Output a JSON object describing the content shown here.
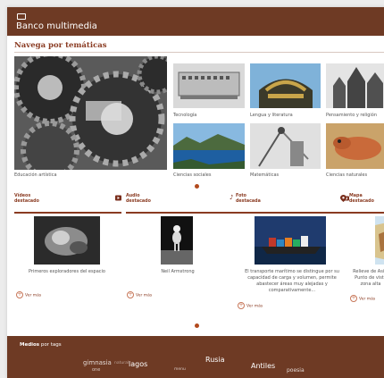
{
  "header": {
    "title": "Banco multimedia",
    "icon": "monitor-icon"
  },
  "themes": {
    "title": "Navega por temáticas",
    "items": [
      {
        "label": "Educación artística"
      },
      {
        "label": "Tecnología"
      },
      {
        "label": "Lengua y literatura"
      },
      {
        "label": "Pensamiento y religión"
      },
      {
        "label": "Ciencias sociales"
      },
      {
        "label": "Matemáticas"
      },
      {
        "label": "Ciencias naturales"
      }
    ]
  },
  "media": [
    {
      "label": "Vídeos destacado",
      "line1": "Vídeos",
      "line2": "destacado",
      "icon": "play-icon",
      "caption": "Primeros exploradores del espacio",
      "more": "Ver más"
    },
    {
      "label": "Audio destacado",
      "line1": "Audio",
      "line2": "destacado",
      "icon": "music-note-icon",
      "caption": "Neil Armstrong",
      "more": "Ver más"
    },
    {
      "label": "Foto destacada",
      "line1": "Foto",
      "line2": "destacada",
      "icon": "camera-icon",
      "caption": "El transporte marítimo se distingue por su capacidad de carga y volumen, permite abastecer áreas muy alejadas y comparativamente...",
      "more": "Ver más"
    },
    {
      "label": "Mapa destacado",
      "line1": "Mapa",
      "line2": "destacado",
      "icon": "map-pin-icon",
      "caption": "Relieve de Asia. Punto de vista zona alta",
      "more": "Ver más"
    }
  ],
  "footer": {
    "title_strong": "Medios",
    "title_rest": " por tags",
    "tags": [
      "gimnasia",
      "one",
      "natural",
      "lagos",
      "menu",
      "Rusia",
      "Antiles",
      "poesia"
    ]
  },
  "colors": {
    "brand": "#6e3a24",
    "accent": "#8a3b22",
    "dot": "#b24a1e"
  }
}
